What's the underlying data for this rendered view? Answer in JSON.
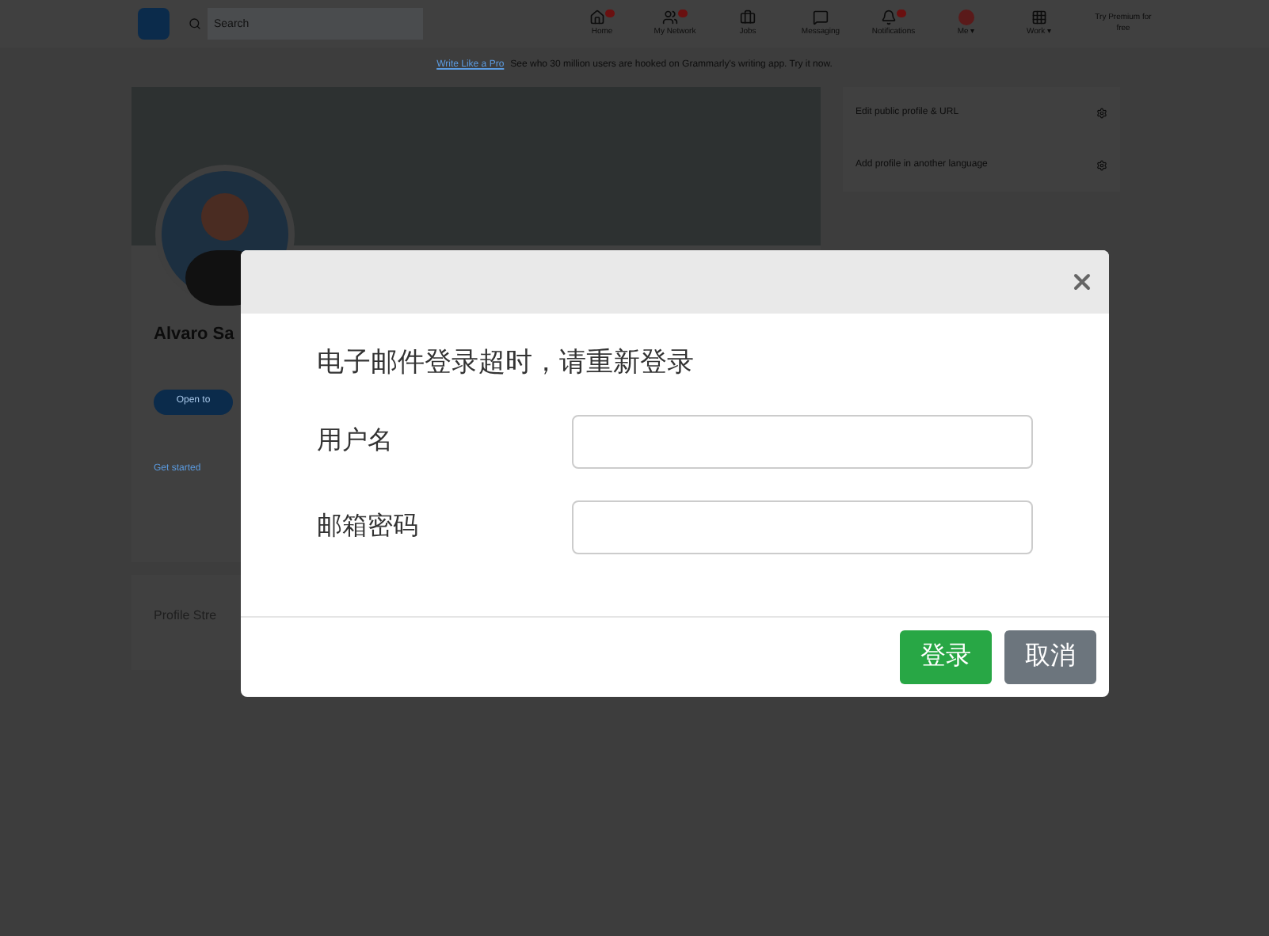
{
  "page": {
    "search": {
      "placeholder": "Search"
    },
    "nav": [
      {
        "label": "Home",
        "badge": true
      },
      {
        "label": "My Network",
        "badge": true
      },
      {
        "label": "Jobs",
        "badge": false
      },
      {
        "label": "Messaging",
        "badge": false
      },
      {
        "label": "Notifications",
        "badge": true
      },
      {
        "label": "Me ▾",
        "badge": false
      },
      {
        "label": "Work ▾",
        "badge": false
      }
    ],
    "premium": "Try Premium for free",
    "banner": {
      "link": "Write Like a Pro",
      "text": "See who 30 million users are hooked on Grammarly's writing app. Try it now."
    },
    "profile": {
      "name": "Alvaro Sa",
      "button": "Open to",
      "link": "Get started",
      "section": "Profile Stre"
    },
    "side_items": [
      "Edit public profile & URL",
      "Add profile in another language"
    ]
  },
  "dialog": {
    "message": "电子邮件登录超时，请重新登录",
    "fields": [
      {
        "label": "用户名"
      },
      {
        "label": "邮箱密码"
      }
    ],
    "buttons": [
      {
        "label": "登录",
        "kind": "primary"
      },
      {
        "label": "取消",
        "kind": "secondary"
      }
    ]
  }
}
